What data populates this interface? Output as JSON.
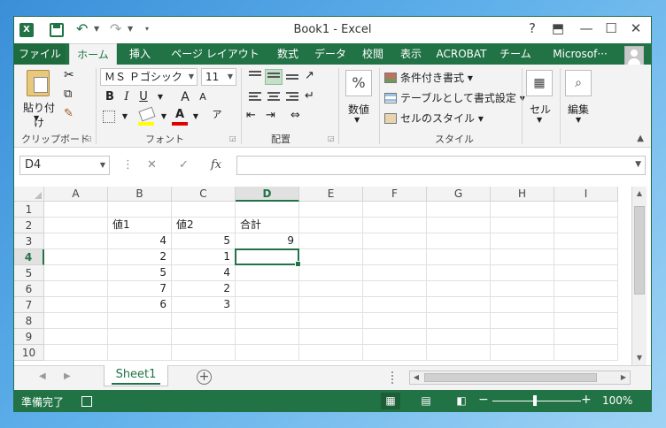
{
  "titlebar": {
    "title": "Book1 - Excel",
    "help": "?",
    "ribbon_display": "⬒",
    "minimize": "—",
    "maximize": "☐",
    "close": "✕",
    "app_icon": "X"
  },
  "tabs": [
    {
      "label": "ファイル"
    },
    {
      "label": "ホーム"
    },
    {
      "label": "挿入"
    },
    {
      "label": "ページ レイアウト"
    },
    {
      "label": "数式"
    },
    {
      "label": "データ"
    },
    {
      "label": "校閲"
    },
    {
      "label": "表示"
    },
    {
      "label": "ACROBAT"
    },
    {
      "label": "チーム"
    },
    {
      "label": "Microsof···"
    }
  ],
  "ribbon": {
    "clipboard": {
      "paste": "貼り付け",
      "group": "クリップボード"
    },
    "font": {
      "name": "ＭＳ Ｐゴシック",
      "size": "11",
      "group": "フォント",
      "bold": "B",
      "italic": "I",
      "underline": "U",
      "grow": "A",
      "shrink": "A"
    },
    "alignment": {
      "group": "配置"
    },
    "number": {
      "label": "数値",
      "symbol": "%",
      "group": ""
    },
    "styles": {
      "conditional": "条件付き書式",
      "table": "テーブルとして書式設定",
      "cell_styles": "セルのスタイル",
      "group": "スタイル"
    },
    "cells": {
      "label": "セル"
    },
    "editing": {
      "label": "編集"
    }
  },
  "formula_bar": {
    "name_box": "D4",
    "cancel": "✕",
    "enter": "✓",
    "fx": "fx",
    "value": ""
  },
  "grid": {
    "columns": [
      "A",
      "B",
      "C",
      "D",
      "E",
      "F",
      "G",
      "H",
      "I"
    ],
    "rows": [
      "1",
      "2",
      "3",
      "4",
      "5",
      "6",
      "7",
      "8",
      "9",
      "10"
    ],
    "selected_cell": "D4",
    "cells": {
      "B2": "値1",
      "C2": "値2",
      "D2": "合計",
      "B3": "4",
      "C3": "5",
      "D3": "9",
      "B4": "2",
      "C4": "1",
      "B5": "5",
      "C5": "4",
      "B6": "7",
      "C6": "2",
      "B7": "6",
      "C7": "3"
    }
  },
  "sheets": {
    "tabs": [
      "Sheet1"
    ],
    "add": "+"
  },
  "status": {
    "text": "準備完了",
    "zoom": "100%",
    "zoom_minus": "−",
    "zoom_plus": "+"
  },
  "colors": {
    "accent": "#217346",
    "ribbon_bg": "#f3f3f3"
  }
}
